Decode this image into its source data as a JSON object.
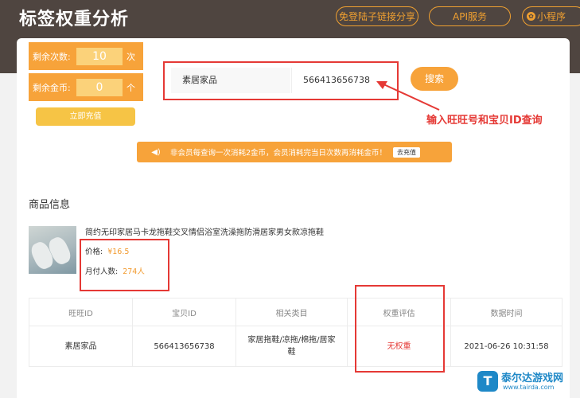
{
  "header": {
    "title": "标签权重分析",
    "share_label": "免登陆子链接分享",
    "api_label": "API服务",
    "mini_label": "小程序",
    "mini_icon": "miniprogram-icon"
  },
  "sidebar": {
    "times_label": "剩余次数:",
    "times_value": "10",
    "times_unit": "次",
    "coins_label": "剩余金币:",
    "coins_value": "0",
    "coins_unit": "个",
    "recharge_label": "立即充值"
  },
  "search": {
    "wangwang_value": "素居家品",
    "itemid_value": "566413656738",
    "button_label": "搜索"
  },
  "annotation": {
    "text": "输入旺旺号和宝贝ID查询",
    "color": "#e53935"
  },
  "notice": {
    "icon": "speaker-icon",
    "text": "非会员每查询一次消耗2金币，会员消耗完当日次数再消耗金币！",
    "button_label": "去充值"
  },
  "product": {
    "section_title": "商品信息",
    "title": "简约无印家居马卡龙拖鞋交叉情侣浴室洗澡拖防滑居家男女款凉拖鞋",
    "price_label": "价格:",
    "price_value": "¥16.5",
    "buyers_label": "月付人数:",
    "buyers_value": "274人"
  },
  "table": {
    "headers": [
      "旺旺ID",
      "宝贝ID",
      "相关类目",
      "权重评估",
      "数据时间"
    ],
    "rows": [
      [
        "素居家品",
        "566413656738",
        "家居拖鞋/凉拖/棉拖/居家鞋",
        "无权重",
        "2021-06-26 10:31:58"
      ]
    ]
  },
  "watermark": {
    "logo_text": "T",
    "name": "泰尔达游戏网",
    "url": "www.tairda.com"
  },
  "colors": {
    "accent": "#f7a33a",
    "header_bg": "#4f4540",
    "highlight": "#e53935"
  }
}
